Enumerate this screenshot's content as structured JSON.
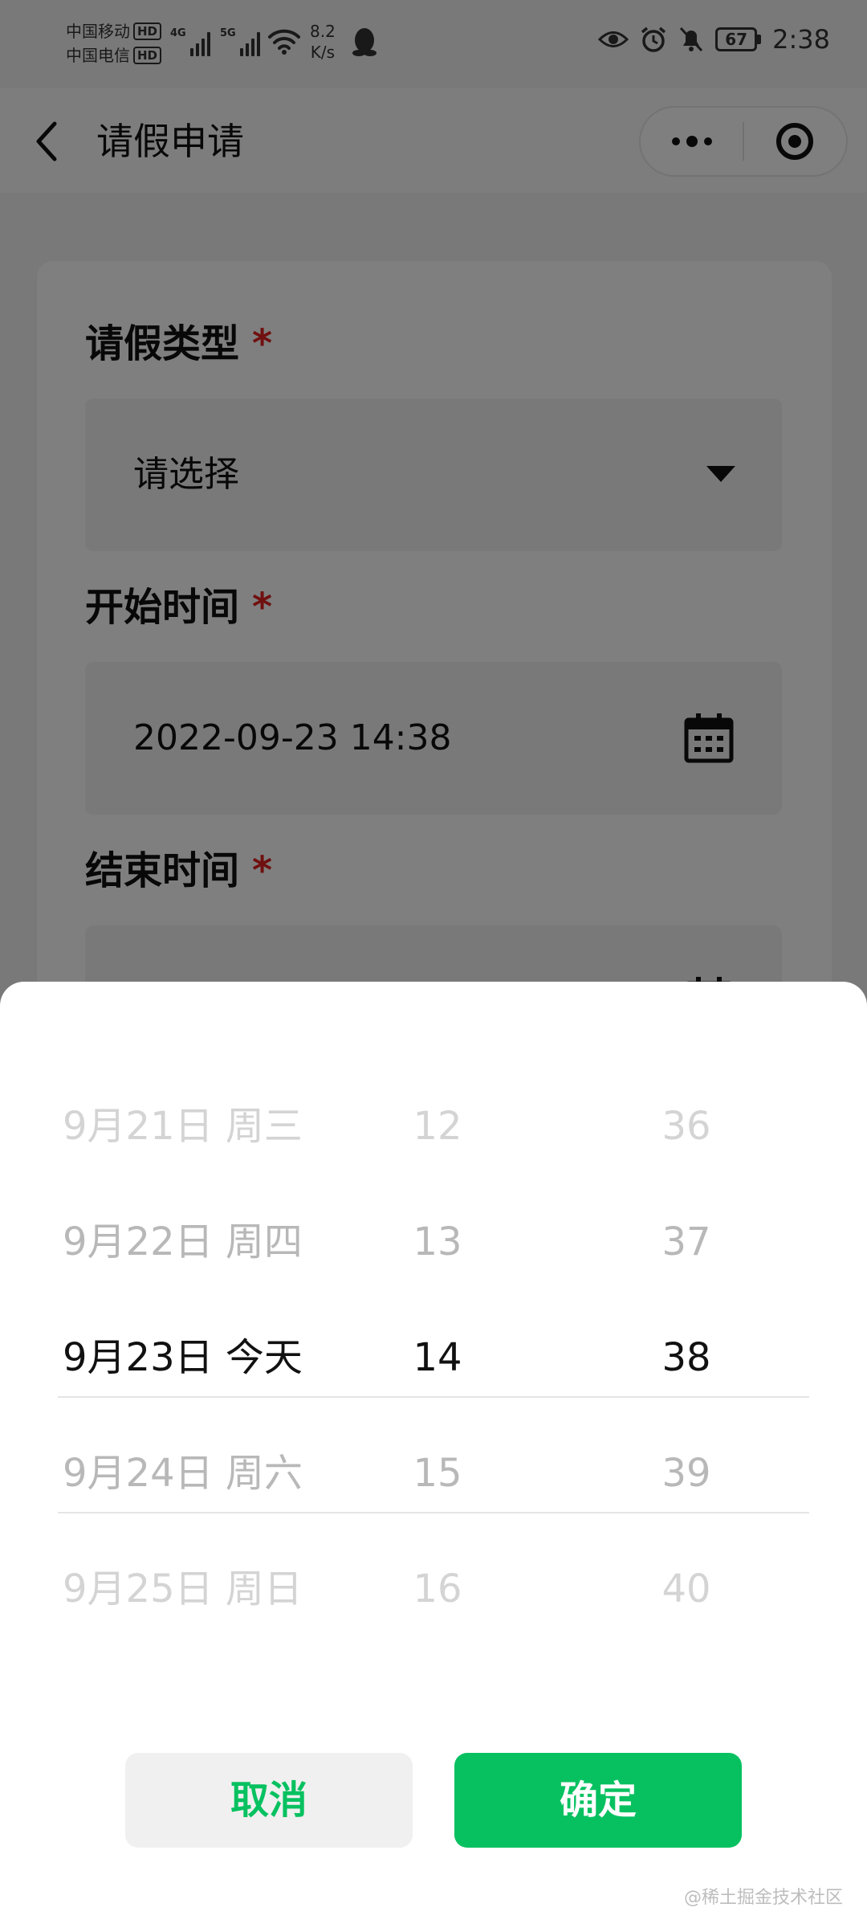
{
  "status_bar": {
    "carrier1": "中国移动",
    "carrier2": "中国电信",
    "hd": "HD",
    "net1": "4G",
    "net2": "5G",
    "speed_value": "8.2",
    "speed_unit": "K/s",
    "battery": "67",
    "time": "2:38"
  },
  "nav": {
    "title": "请假申请"
  },
  "form": {
    "leave_type": {
      "label": "请假类型",
      "required_mark": "*",
      "value": "请选择"
    },
    "start_time": {
      "label": "开始时间",
      "required_mark": "*",
      "value": "2022-09-23 14:38"
    },
    "end_time": {
      "label": "结束时间",
      "required_mark": "*"
    }
  },
  "picker": {
    "dates": [
      "9月21日 周三",
      "9月22日 周四",
      "9月23日 今天",
      "9月24日 周六",
      "9月25日 周日"
    ],
    "hours": [
      "12",
      "13",
      "14",
      "15",
      "16"
    ],
    "minutes": [
      "36",
      "37",
      "38",
      "39",
      "40"
    ],
    "selected_index": 2
  },
  "buttons": {
    "cancel": "取消",
    "confirm": "确定"
  },
  "watermark": "@稀土掘金技术社区",
  "colors": {
    "accent": "#07c160",
    "required": "#e02020"
  }
}
